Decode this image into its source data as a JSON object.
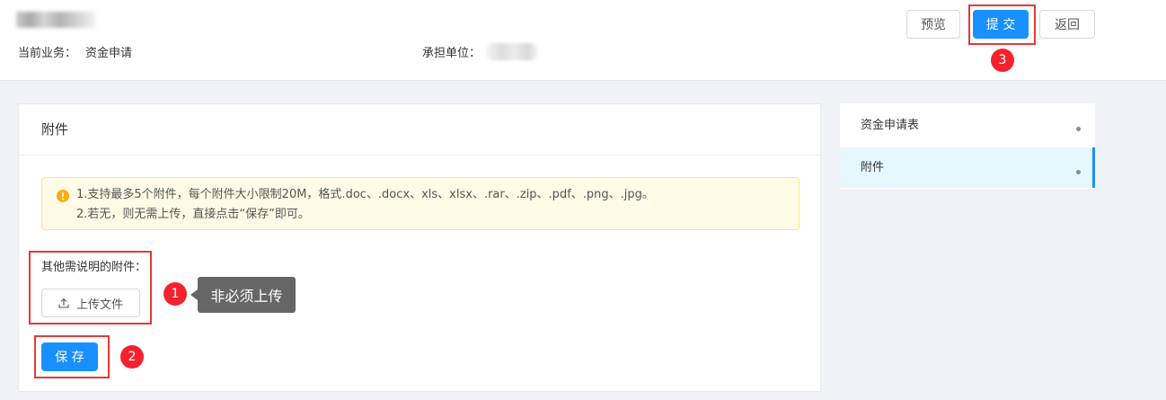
{
  "header": {
    "business_label": "当前业务：",
    "business_value": "资金申请",
    "unit_label": "承担单位：",
    "actions": {
      "preview": "预览",
      "submit": "提 交",
      "back": "返回"
    }
  },
  "main": {
    "card_title": "附件",
    "alert": {
      "icon": "warning-icon",
      "lines": [
        "1.支持最多5个附件，每个附件大小限制20M，格式.doc、.docx、xls、xlsx、.rar、.zip、.pdf、.png、.jpg。",
        "2.若无，则无需上传，直接点击“保存”即可。"
      ]
    },
    "upload": {
      "label": "其他需说明的附件：",
      "button_label": "上传文件",
      "icon": "upload-icon"
    },
    "save_label": "保 存"
  },
  "annotations": [
    {
      "number": "1",
      "tooltip": "非必须上传"
    },
    {
      "number": "2"
    },
    {
      "number": "3"
    }
  ],
  "side_nav": {
    "items": [
      {
        "label": "资金申请表",
        "active": false
      },
      {
        "label": "附件",
        "active": true
      }
    ]
  },
  "colors": {
    "primary": "#1890ff",
    "highlight_red": "#e53935",
    "badge_red": "#f5222d",
    "tooltip_bg": "#666666",
    "alert_bg": "#fffbe6",
    "alert_border": "#ffe58f",
    "warning": "#faad14",
    "nav_active_bg": "#e6f7ff",
    "page_bg": "#f0f2f5"
  }
}
